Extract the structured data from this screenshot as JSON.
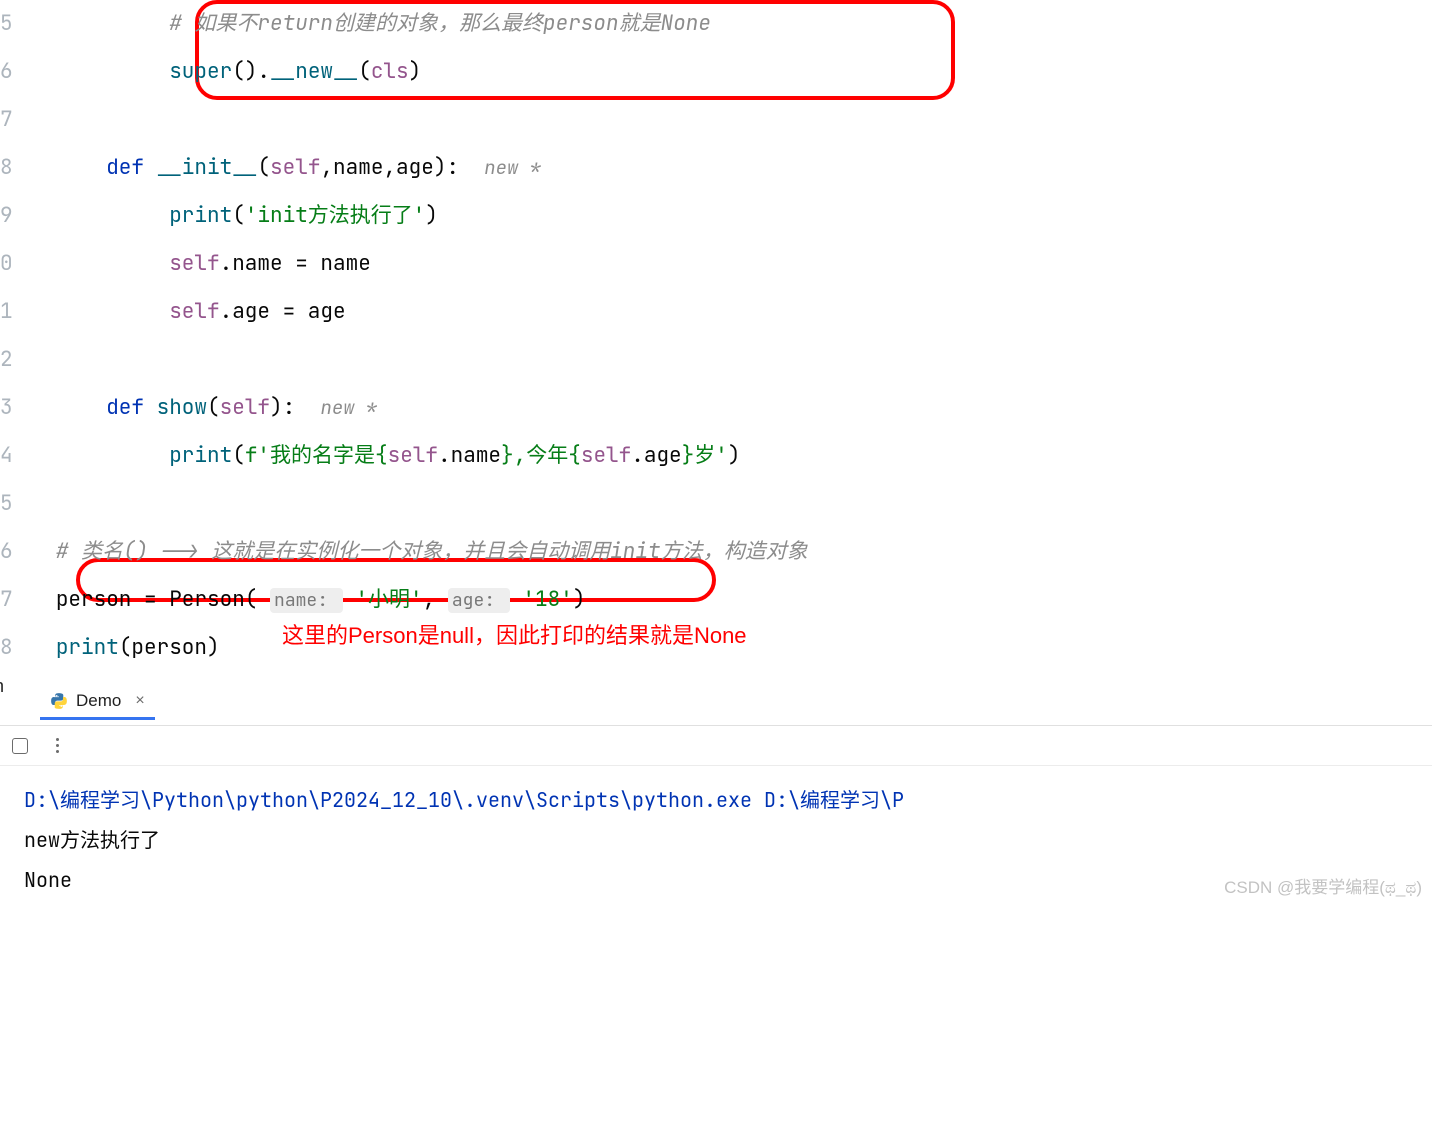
{
  "code": {
    "comment1": "# 如果不return创建的对象，那么最终person就是None",
    "super_call_a": "super",
    "super_call_b": "().",
    "super_call_c": "__new__",
    "super_call_d": "(",
    "super_call_cls": "cls",
    "super_call_e": ")",
    "def_kw": "def ",
    "init_name": "__init__",
    "init_params_a": "(",
    "init_self": "self",
    "init_params_b": ",name,age):  ",
    "init_hint": "new *",
    "print_init_a": "print",
    "print_init_b": "(",
    "print_init_s": "'init方法执行了'",
    "print_init_c": ")",
    "self_name_a": "self",
    "self_name_b": ".name = name",
    "self_age_a": "self",
    "self_age_b": ".age = age",
    "show_name": "show",
    "show_params_a": "(",
    "show_self": "self",
    "show_params_b": "):  ",
    "show_hint": "new *",
    "print_show_a": "print",
    "print_show_b": "(",
    "fstr_prefix": "f",
    "fstr_q1": "'我的名字是{",
    "fstr_self1": "self",
    "fstr_mid1": ".name",
    "fstr_q2": "},今年{",
    "fstr_self2": "self",
    "fstr_mid2": ".age",
    "fstr_q3": "}岁'",
    "print_show_c": ")",
    "comment2": "# 类名() --> 这就是在实例化一个对象，并且会自动调用init方法，构造对象",
    "person_a": "person = Person( ",
    "hint_name": "name: ",
    "arg_name": "'小明'",
    "person_b": ", ",
    "hint_age": "age: ",
    "arg_age": "'18'",
    "person_c": ")",
    "print_person_a": "print",
    "print_person_b": "(person)"
  },
  "gutter": [
    "5",
    "6",
    "7",
    "8",
    "9",
    "0",
    "1",
    "2",
    "3",
    "4",
    "5",
    "6",
    "7",
    "8"
  ],
  "annotation": "这里的Person是null，因此打印的结果就是None",
  "tab": {
    "label": "Demo",
    "close": "×"
  },
  "left_label": "n",
  "console": {
    "cmd": "D:\\编程学习\\Python\\python\\P2024_12_10\\.venv\\Scripts\\python.exe D:\\编程学习\\P",
    "out1": "new方法执行了",
    "out2": "None"
  },
  "watermark": "CSDN @我要学编程(ಥ_ಥ)"
}
